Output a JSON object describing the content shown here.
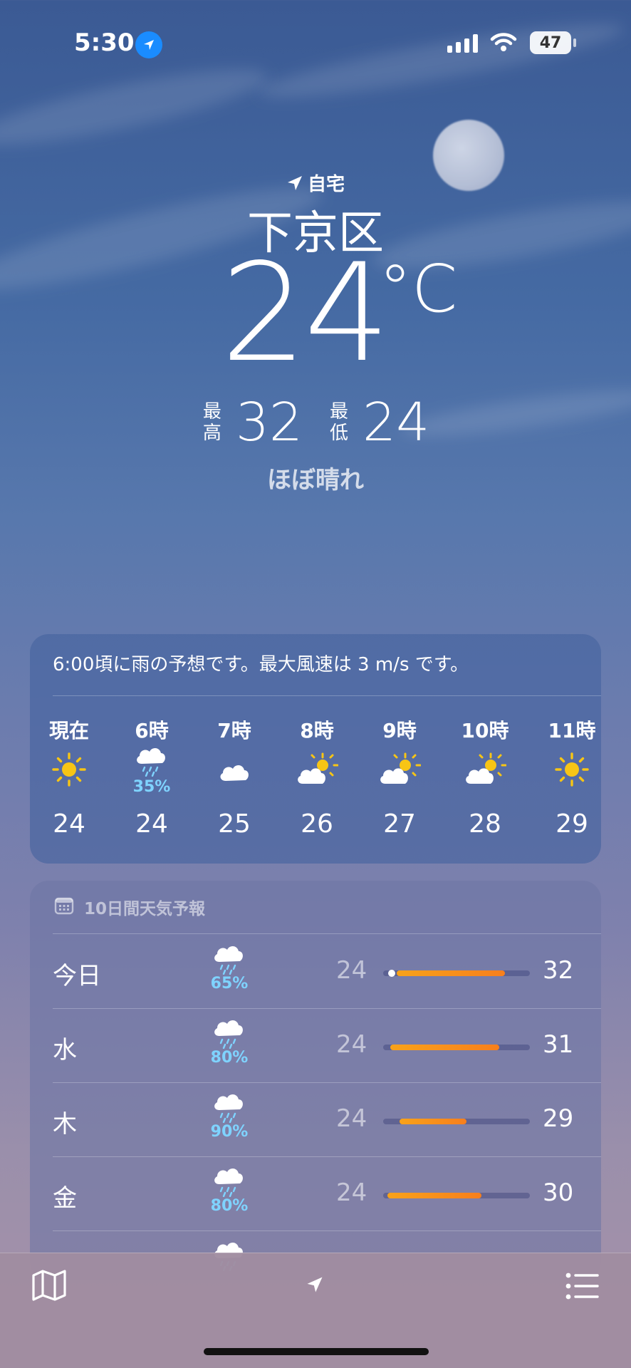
{
  "status_bar": {
    "time": "5:30",
    "battery": "47"
  },
  "header": {
    "home_label": "自宅",
    "city": "下京区",
    "temperature": "24",
    "unit": "°C",
    "high_label_1": "最",
    "high_label_2": "高",
    "high": "32",
    "low_label_1": "最",
    "low_label_2": "低",
    "low": "24",
    "condition": "ほぼ晴れ"
  },
  "hourly": {
    "summary": "6:00頃に雨の予想です。最大風速は 3 m/s です。",
    "hours": [
      {
        "label": "現在",
        "icon": "sun-icon",
        "pct": "",
        "temp": "24"
      },
      {
        "label": "6時",
        "icon": "rain-cloud-icon",
        "pct": "35%",
        "temp": "24"
      },
      {
        "label": "7時",
        "icon": "cloud-icon",
        "pct": "",
        "temp": "25"
      },
      {
        "label": "8時",
        "icon": "partly-cloudy-icon",
        "pct": "",
        "temp": "26"
      },
      {
        "label": "9時",
        "icon": "partly-cloudy-icon",
        "pct": "",
        "temp": "27"
      },
      {
        "label": "10時",
        "icon": "partly-cloudy-icon",
        "pct": "",
        "temp": "28"
      },
      {
        "label": "11時",
        "icon": "sun-icon",
        "pct": "",
        "temp": "29"
      }
    ]
  },
  "daily": {
    "title": "10日間天気予報",
    "days": [
      {
        "name": "今日",
        "icon": "rain-cloud-icon",
        "pct": "65%",
        "low": "24",
        "high": "32",
        "range_start": 0.09,
        "range_end": 0.83,
        "current": 0.06
      },
      {
        "name": "水",
        "icon": "rain-cloud-icon",
        "pct": "80%",
        "low": "24",
        "high": "31",
        "range_start": 0.05,
        "range_end": 0.79
      },
      {
        "name": "木",
        "icon": "rain-cloud-icon",
        "pct": "90%",
        "low": "24",
        "high": "29",
        "range_start": 0.11,
        "range_end": 0.57
      },
      {
        "name": "金",
        "icon": "rain-cloud-icon",
        "pct": "80%",
        "low": "24",
        "high": "30",
        "range_start": 0.03,
        "range_end": 0.67
      }
    ]
  },
  "colors": {
    "bar_start": "#f8a21a",
    "bar_end": "#f77f1c",
    "precip": "#7fd3ff"
  }
}
